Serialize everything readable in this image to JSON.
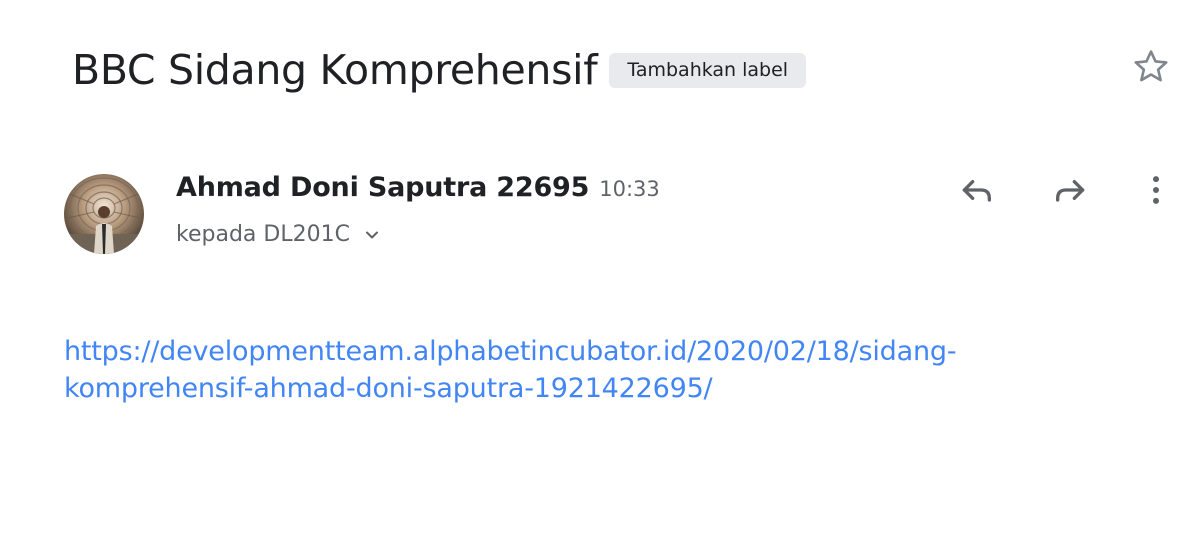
{
  "email": {
    "subject": "BBC Sidang Komprehensif",
    "label_chip": "Tambahkan label",
    "sender_name": "Ahmad Doni Saputra 22695",
    "time": "10:33",
    "recipient": "kepada DL201C",
    "body_link_line1": "https://developmentteam.alphabetincubator.id/2020/02/18/sidang-",
    "body_link_line2": "komprehensif-ahmad-doni-saputra-1921422695/",
    "body_link_href": "https://developmentteam.alphabetincubator.id/2020/02/18/sidang-komprehensif-ahmad-doni-saputra-1921422695/"
  },
  "icons": {
    "star": "star-outline-icon",
    "reply": "reply-icon",
    "forward": "forward-icon",
    "more": "more-vert-icon",
    "expand": "chevron-down-icon"
  },
  "colors": {
    "link": "#4285f4",
    "text_primary": "#202124",
    "text_secondary": "#5f6368",
    "chip_bg": "#e8eaed"
  }
}
